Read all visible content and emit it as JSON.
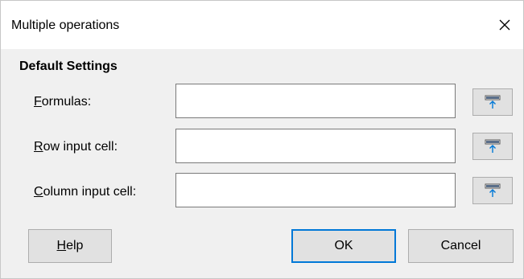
{
  "window": {
    "title": "Multiple operations",
    "close_icon": "close-icon"
  },
  "section": {
    "title": "Default Settings"
  },
  "fields": [
    {
      "label_mnemonic": "F",
      "label_rest": "ormulas:",
      "value": "",
      "picker_icon": "shrink-dialog-icon"
    },
    {
      "label_mnemonic": "R",
      "label_rest": "ow input cell:",
      "value": "",
      "picker_icon": "shrink-dialog-icon"
    },
    {
      "label_mnemonic": "C",
      "label_rest": "olumn input cell:",
      "value": "",
      "picker_icon": "shrink-dialog-icon"
    }
  ],
  "buttons": {
    "help_mnemonic": "H",
    "help_rest": "elp",
    "ok": "OK",
    "cancel": "Cancel"
  },
  "colors": {
    "dialog_background": "#f0f0f0",
    "titlebar_background": "#ffffff",
    "button_background": "#e1e1e1",
    "default_button_border": "#0078d7",
    "icon_blue": "#0078d7"
  }
}
